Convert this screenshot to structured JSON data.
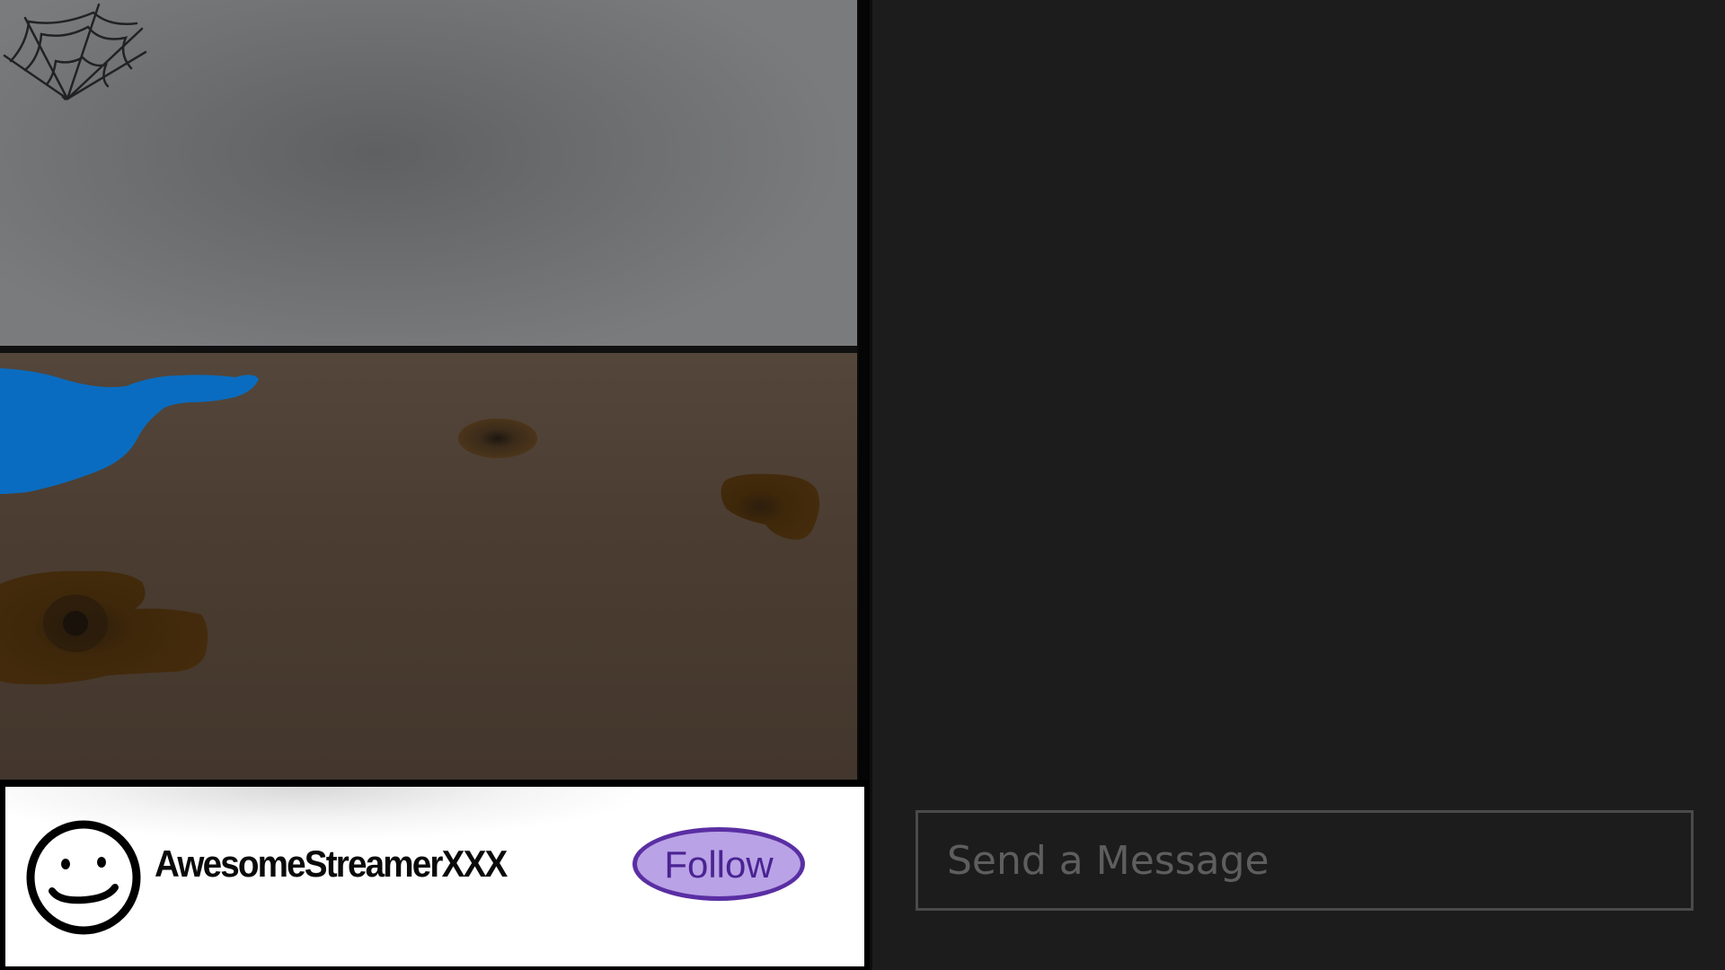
{
  "stream": {
    "streamer_name": "AwesomeStreamerXXX",
    "follow_label": "Follow"
  },
  "chat": {
    "input_placeholder": "Send a Message",
    "input_value": ""
  },
  "colors": {
    "follow_fill": "#b9a2e6",
    "follow_border": "#5a2ea3",
    "chat_background": "#1c1c1c",
    "water": "#0a6cc0",
    "sky": "#6b6c6e",
    "ground": "#4b3d31"
  },
  "icons": {
    "avatar": "smiley-face-icon",
    "decoration": "spider-web-icon"
  }
}
